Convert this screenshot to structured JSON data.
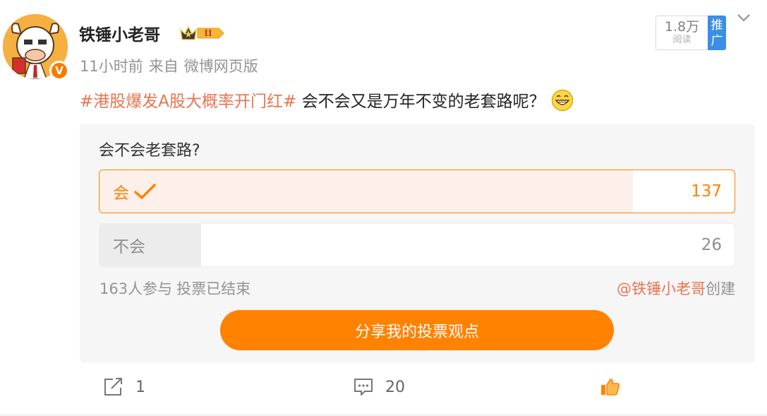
{
  "author": {
    "name": "铁锤小老哥",
    "vip_level": "II",
    "verified_mark": "V",
    "avatar_icon": "cartoon-bull-avatar"
  },
  "meta": {
    "time": "11小时前",
    "source_prefix": "来自",
    "source": "微博网页版"
  },
  "stats": {
    "read_count": "1.8万",
    "read_label": "阅读",
    "promote_label": "推广"
  },
  "post": {
    "topic": "#港股爆发A股大概率开门红#",
    "text": " 会不会又是万年不变的老套路呢？",
    "emoji": "grin-emoji"
  },
  "poll": {
    "question": "会不会老套路?",
    "options": [
      {
        "label": "会",
        "count": "137",
        "fraction": 0.84,
        "selected": true
      },
      {
        "label": "不会",
        "count": "26",
        "fraction": 0.16,
        "selected": false
      }
    ],
    "participants": "163人参与",
    "status": "投票已结束",
    "creator": "@铁锤小老哥",
    "creator_suffix": "创建",
    "share_label": "分享我的投票观点"
  },
  "actions": {
    "forward_count": "1",
    "comment_count": "20"
  },
  "colors": {
    "accent": "#ff8200",
    "topic": "#eb7350",
    "promo": "#3a8ee6"
  }
}
